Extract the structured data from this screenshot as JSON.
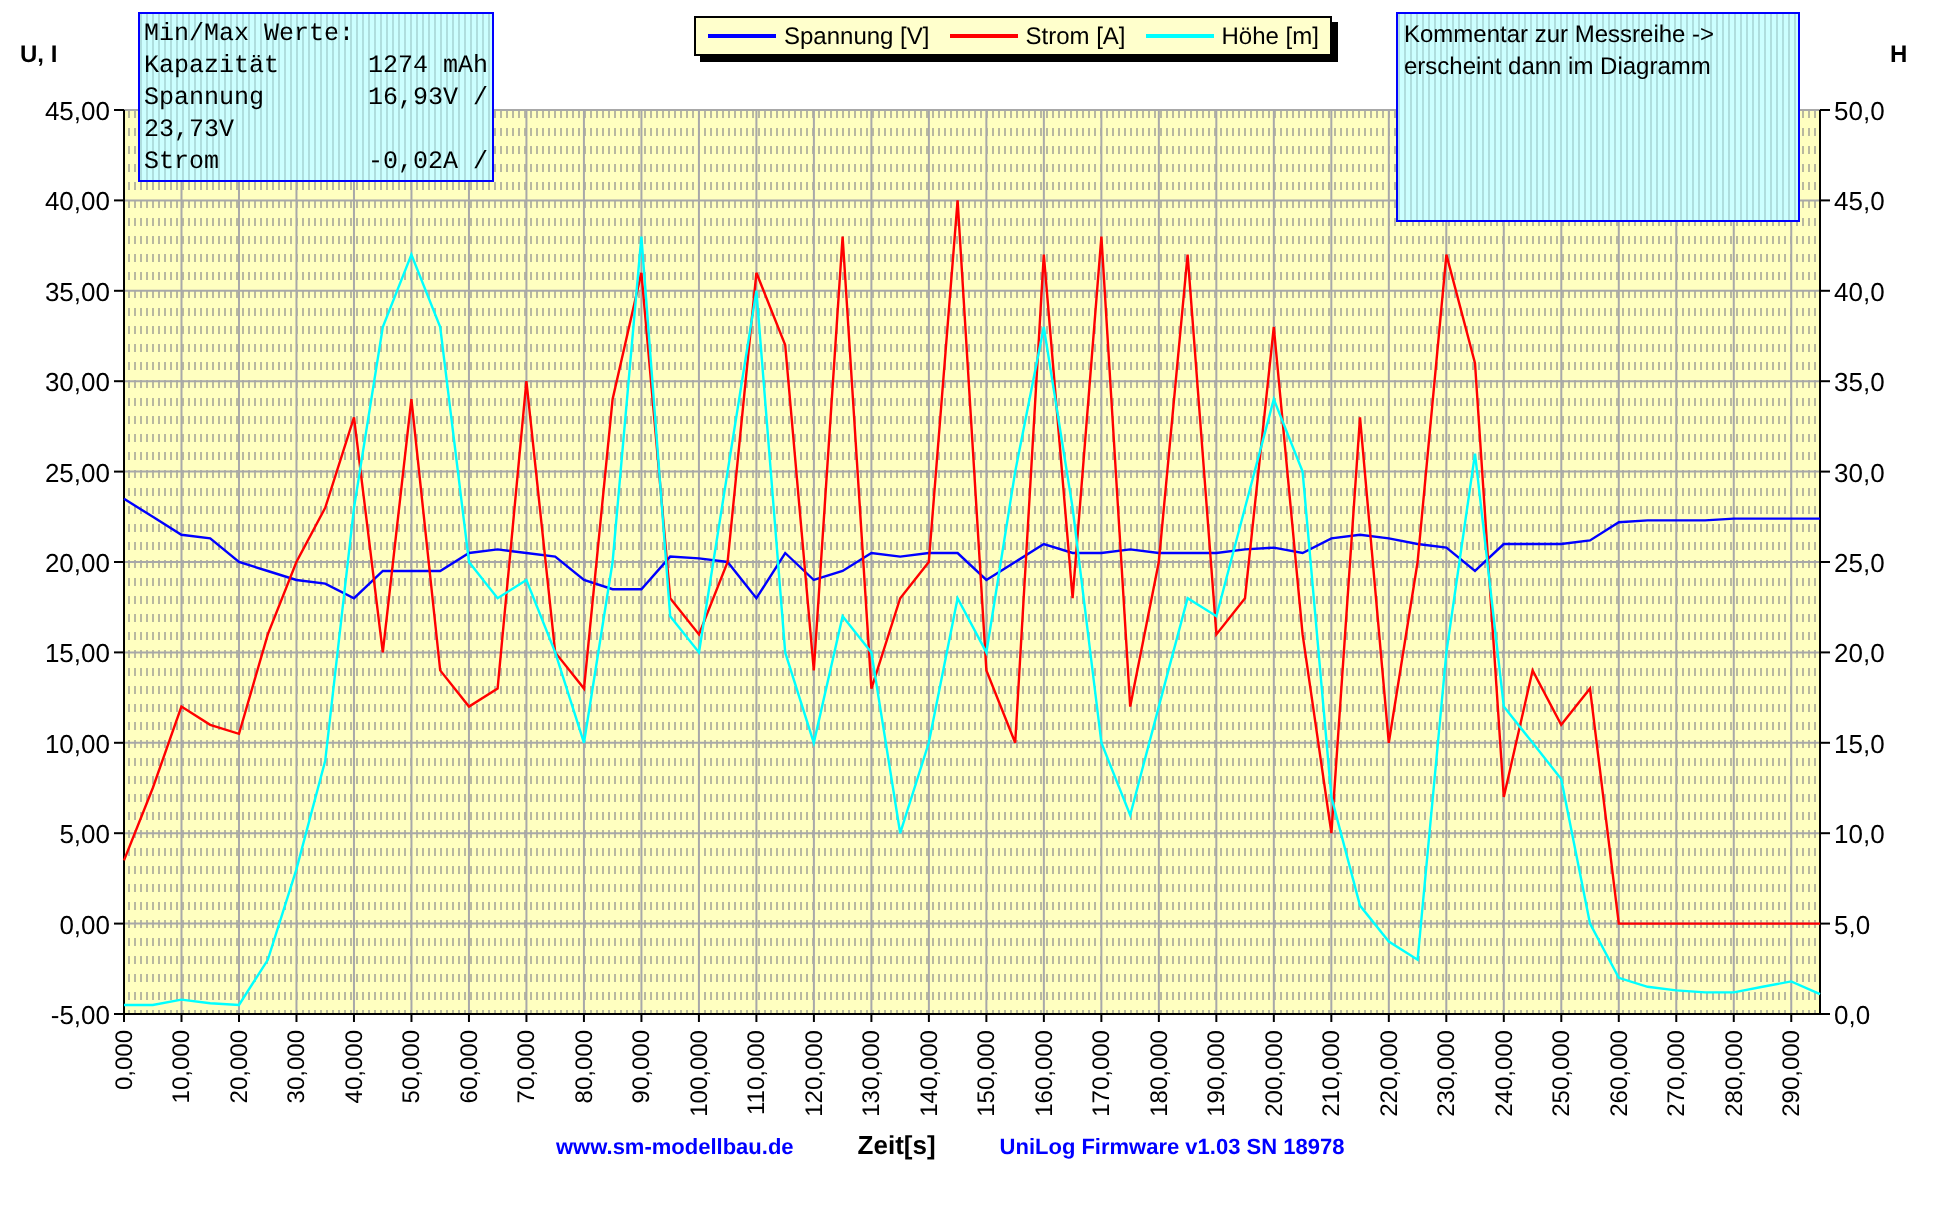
{
  "stats": {
    "title": "Min/Max Werte:",
    "rows": [
      {
        "label": "Kapazität",
        "value": "1274 mAh"
      },
      {
        "label": "Spannung",
        "value": "16,93V /"
      },
      {
        "label": "23,73V"
      },
      {
        "label": "Strom",
        "value": "-0,02A /"
      }
    ]
  },
  "comment": "Kommentar zur Messreihe -> erscheint dann im Diagramm",
  "chart_data": {
    "type": "line",
    "xlabel": "Zeit[s]",
    "ylabel": "U, I",
    "y2label": "H",
    "grid": true,
    "x": [
      0,
      5,
      10,
      15,
      20,
      25,
      30,
      35,
      40,
      45,
      50,
      55,
      60,
      65,
      70,
      75,
      80,
      85,
      90,
      95,
      100,
      105,
      110,
      115,
      120,
      125,
      130,
      135,
      140,
      145,
      150,
      155,
      160,
      165,
      170,
      175,
      180,
      185,
      190,
      195,
      200,
      205,
      210,
      215,
      220,
      225,
      230,
      235,
      240,
      245,
      250,
      255,
      260,
      265,
      270,
      275,
      280,
      285,
      290,
      295
    ],
    "xlim": [
      0,
      295
    ],
    "ylim": [
      -5,
      45
    ],
    "y2lim": [
      0,
      50
    ],
    "xticks": [
      {
        "value": 0,
        "label": "0,000"
      },
      {
        "value": 10,
        "label": "10,000"
      },
      {
        "value": 20,
        "label": "20,000"
      },
      {
        "value": 30,
        "label": "30,000"
      },
      {
        "value": 40,
        "label": "40,000"
      },
      {
        "value": 50,
        "label": "50,000"
      },
      {
        "value": 60,
        "label": "60,000"
      },
      {
        "value": 70,
        "label": "70,000"
      },
      {
        "value": 80,
        "label": "80,000"
      },
      {
        "value": 90,
        "label": "90,000"
      },
      {
        "value": 100,
        "label": "100,000"
      },
      {
        "value": 110,
        "label": "110,000"
      },
      {
        "value": 120,
        "label": "120,000"
      },
      {
        "value": 130,
        "label": "130,000"
      },
      {
        "value": 140,
        "label": "140,000"
      },
      {
        "value": 150,
        "label": "150,000"
      },
      {
        "value": 160,
        "label": "160,000"
      },
      {
        "value": 170,
        "label": "170,000"
      },
      {
        "value": 180,
        "label": "180,000"
      },
      {
        "value": 190,
        "label": "190,000"
      },
      {
        "value": 200,
        "label": "200,000"
      },
      {
        "value": 210,
        "label": "210,000"
      },
      {
        "value": 220,
        "label": "220,000"
      },
      {
        "value": 230,
        "label": "230,000"
      },
      {
        "value": 240,
        "label": "240,000"
      },
      {
        "value": 250,
        "label": "250,000"
      },
      {
        "value": 260,
        "label": "260,000"
      },
      {
        "value": 270,
        "label": "270,000"
      },
      {
        "value": 280,
        "label": "280,000"
      },
      {
        "value": 290,
        "label": "290,000"
      }
    ],
    "yticks": [
      {
        "value": 45,
        "label": "45,00"
      },
      {
        "value": 40,
        "label": "40,00"
      },
      {
        "value": 35,
        "label": "35,00"
      },
      {
        "value": 30,
        "label": "30,00"
      },
      {
        "value": 25,
        "label": "25,00"
      },
      {
        "value": 20,
        "label": "20,00"
      },
      {
        "value": 15,
        "label": "15,00"
      },
      {
        "value": 10,
        "label": "10,00"
      },
      {
        "value": 5,
        "label": "5,00"
      },
      {
        "value": 0,
        "label": "0,00"
      },
      {
        "value": -5,
        "label": "-5,00"
      }
    ],
    "y2ticks": [
      {
        "value": 50,
        "label": "50,0"
      },
      {
        "value": 45,
        "label": "45,0"
      },
      {
        "value": 40,
        "label": "40,0"
      },
      {
        "value": 35,
        "label": "35,0"
      },
      {
        "value": 30,
        "label": "30,0"
      },
      {
        "value": 25,
        "label": "25,0"
      },
      {
        "value": 20,
        "label": "20,0"
      },
      {
        "value": 15,
        "label": "15,0"
      },
      {
        "value": 10,
        "label": "10,0"
      },
      {
        "value": 5,
        "label": "5,0"
      },
      {
        "value": 0,
        "label": "0,0"
      }
    ],
    "series": [
      {
        "name": "Spannung [V]",
        "color": "#0000ff",
        "values": [
          23.5,
          22.5,
          21.5,
          21.3,
          20,
          19.5,
          19,
          18.8,
          18,
          19.5,
          19.5,
          19.5,
          20.5,
          20.7,
          20.5,
          20.3,
          19,
          18.5,
          18.5,
          20.3,
          20.2,
          20,
          18,
          20.5,
          19,
          19.5,
          20.5,
          20.3,
          20.5,
          20.5,
          19,
          20,
          21,
          20.5,
          20.5,
          20.7,
          20.5,
          20.5,
          20.5,
          20.7,
          20.8,
          20.5,
          21.3,
          21.5,
          21.3,
          21,
          20.8,
          19.5,
          21,
          21,
          21,
          21.2,
          22.2,
          22.3,
          22.3,
          22.3,
          22.4,
          22.4,
          22.4,
          22.4
        ]
      },
      {
        "name": "Strom [A]",
        "color": "#ff0000",
        "values": [
          3.5,
          7.5,
          12,
          11,
          10.5,
          16,
          20,
          23,
          28,
          15,
          29,
          14,
          12,
          13,
          30,
          15,
          13,
          29,
          36,
          18,
          16,
          20,
          36,
          32,
          14,
          38,
          13,
          18,
          20,
          40,
          14,
          10,
          37,
          18,
          38,
          12,
          20,
          37,
          16,
          18,
          33,
          16,
          5,
          28,
          10,
          20,
          37,
          31,
          7,
          14,
          11,
          13,
          0,
          0,
          0,
          0,
          0,
          0,
          0,
          0
        ]
      },
      {
        "name": "Höhe [m]",
        "color": "#00ffff",
        "axis": "y2",
        "values": [
          0.5,
          0.5,
          0.8,
          0.6,
          0.5,
          3,
          8,
          14,
          28,
          38,
          42,
          38,
          25,
          23,
          24,
          20,
          15,
          25,
          43,
          22,
          20,
          30,
          40,
          20,
          15,
          22,
          20,
          10,
          15,
          23,
          20,
          30,
          38,
          28,
          15,
          11,
          17,
          23,
          22,
          28,
          34,
          30,
          12,
          6,
          4,
          3,
          20,
          31,
          17,
          15,
          13,
          5,
          2,
          1.5,
          1.3,
          1.2,
          1.2,
          1.5,
          1.8,
          1.1
        ]
      }
    ]
  },
  "footer": {
    "website": "www.sm-modellbau.de",
    "firmware": "UniLog Firmware v1.03 SN 18978"
  }
}
